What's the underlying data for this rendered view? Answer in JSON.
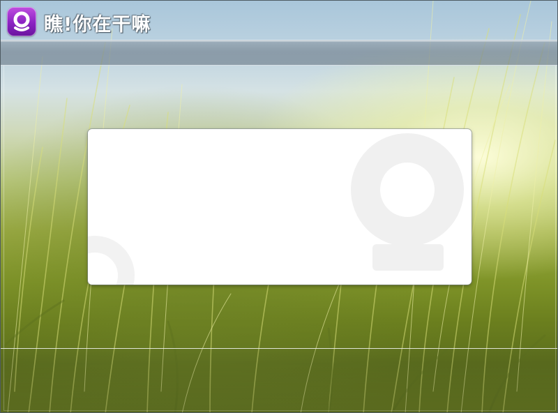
{
  "window": {
    "title": "瞧!你在干嘛"
  },
  "logo": {
    "icon": "app-logo-q-icon",
    "color": "#9b2fd0"
  },
  "panel": {
    "watermark_icon": "logo-watermark-icon",
    "background": "#ffffff"
  }
}
